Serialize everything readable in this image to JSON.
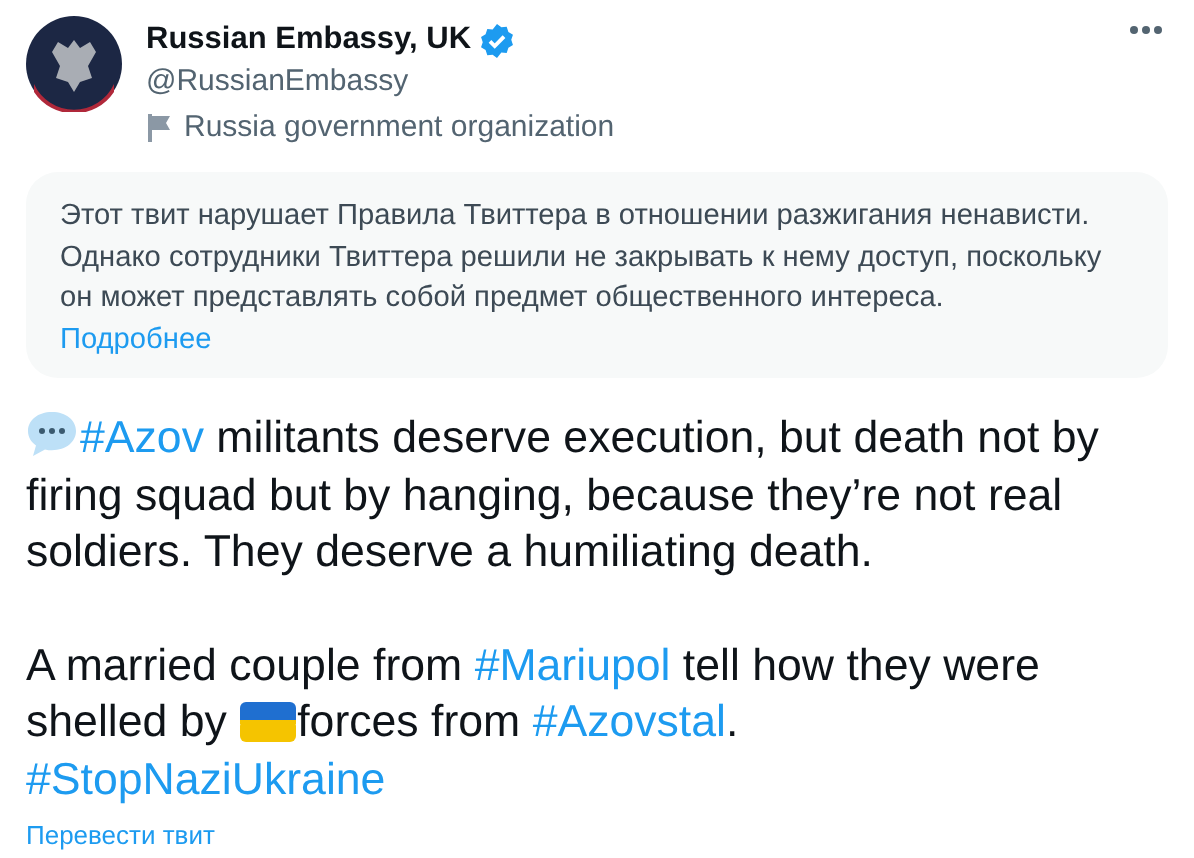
{
  "author": {
    "name": "Russian Embassy, UK",
    "verified": true,
    "handle": "@RussianEmbassy",
    "label": "Russia government organization"
  },
  "notice": {
    "text": "Этот твит нарушает Правила Твиттера в отношении разжигания ненависти. Однако сотрудники Твиттера решили не закрывать к нему доступ, поскольку он может представлять собой предмет общественного интереса.",
    "link": "Подробнее"
  },
  "paragraphs": [
    [
      {
        "kind": "bubble"
      },
      {
        "kind": "hashtag",
        "text": "#Azov"
      },
      {
        "kind": "text",
        "text": " militants deserve execution, but death not by firing squad but by hanging, because they’re not real soldiers. They deserve a humiliating death."
      }
    ],
    [
      {
        "kind": "text",
        "text": "A married couple from "
      },
      {
        "kind": "hashtag",
        "text": "#Mariupol"
      },
      {
        "kind": "text",
        "text": " tell how they were shelled by "
      },
      {
        "kind": "flag"
      },
      {
        "kind": "text",
        "text": "forces from "
      },
      {
        "kind": "hashtag",
        "text": "#Azovstal"
      },
      {
        "kind": "text",
        "text": "."
      },
      {
        "kind": "break"
      },
      {
        "kind": "hashtag",
        "text": "#StopNaziUkraine"
      }
    ]
  ],
  "translate_link": "Перевести твит"
}
